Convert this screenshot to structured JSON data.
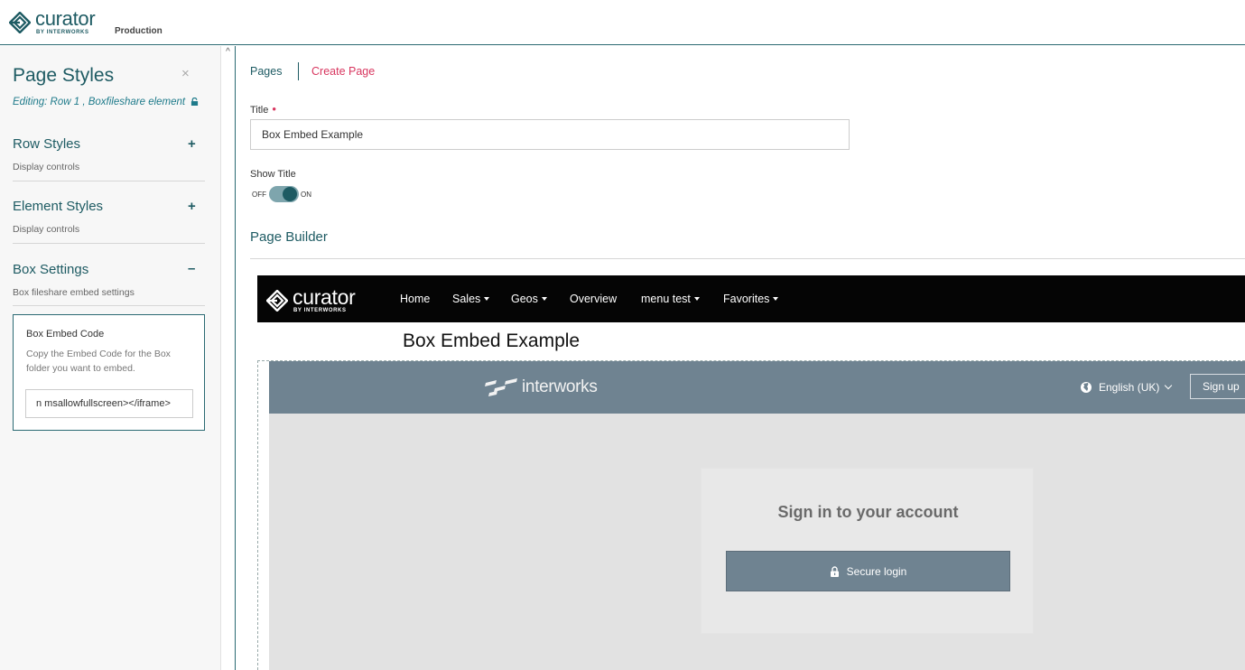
{
  "header": {
    "logo_word": "curator",
    "logo_by": "BY INTERWORKS",
    "environment": "Production"
  },
  "sidebar": {
    "title": "Page Styles",
    "close_glyph": "×",
    "editing": "Editing: Row 1 , Boxfileshare element",
    "sections": [
      {
        "title": "Row Styles",
        "subtitle": "Display controls",
        "toggle": "+"
      },
      {
        "title": "Element Styles",
        "subtitle": "Display controls",
        "toggle": "+"
      },
      {
        "title": "Box Settings",
        "subtitle": "Box fileshare embed settings",
        "toggle": "–"
      }
    ],
    "embed": {
      "title": "Box Embed Code",
      "description": "Copy the Embed Code for the Box folder you want to embed.",
      "value": "n msallowfullscreen></iframe>"
    },
    "scroll_up_glyph": "^"
  },
  "main": {
    "tabs": {
      "pages": "Pages",
      "create": "Create Page"
    },
    "title_label": "Title",
    "required_mark": "•",
    "title_value": "Box Embed Example",
    "show_title_label": "Show Title",
    "toggle_off": "OFF",
    "toggle_on": "ON",
    "page_builder": "Page Builder"
  },
  "preview": {
    "logo_word": "curator",
    "logo_by": "BY INTERWORKS",
    "menu": [
      "Home",
      "Sales",
      "Geos",
      "Overview",
      "menu test",
      "Favorites"
    ],
    "page_title": "Box Embed Example",
    "box": {
      "brand": "interworks",
      "language": "English (UK)",
      "signup": "Sign up",
      "signin_title": "Sign in to your account",
      "secure_login": "Secure login"
    }
  },
  "colors": {
    "brand_teal": "#1e5b63",
    "accent_pink": "#d8365f",
    "box_slate": "#6f8391"
  },
  "icons": {
    "logo": "curator-logo-icon",
    "lock": "lock-icon",
    "globe": "globe-icon",
    "padlock": "padlock-icon"
  }
}
